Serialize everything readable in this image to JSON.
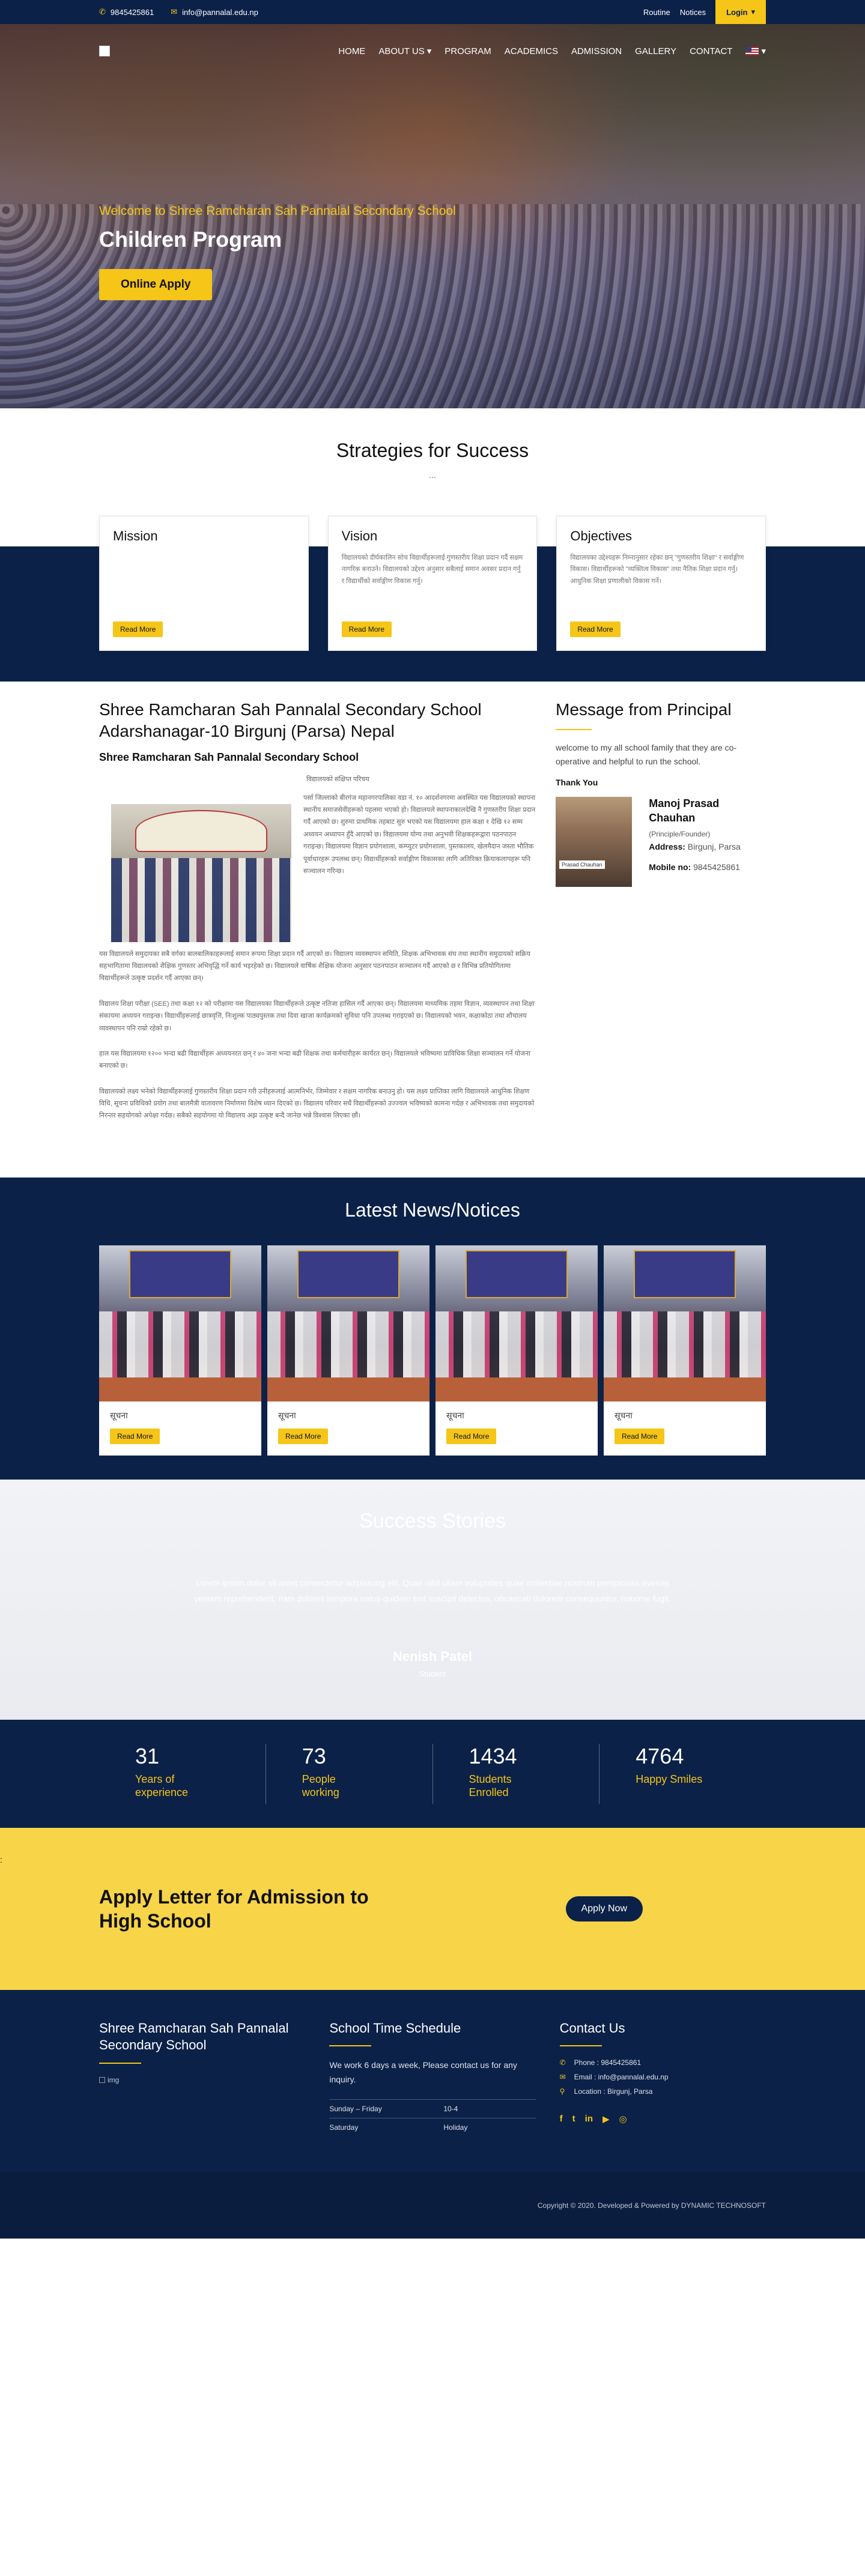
{
  "topbar": {
    "phone": "9845425861",
    "email": "info@pannalal.edu.np",
    "routine": "Routine",
    "notices": "Notices",
    "login": "Login"
  },
  "nav": {
    "items": [
      "HOME",
      "ABOUT US",
      "PROGRAM",
      "ACADEMICS",
      "ADMISSION",
      "GALLERY",
      "CONTACT"
    ]
  },
  "hero": {
    "subtitle": "Welcome to Shree Ramcharan Sah Pannalal Secondary School",
    "title": "Children Program",
    "button": "Online Apply"
  },
  "strategies": {
    "title": "Strategies for Success",
    "dots": "...",
    "cards": [
      {
        "title": "Mission",
        "text": "",
        "button": "Read More"
      },
      {
        "title": "Vision",
        "text": "विद्यालयको दीर्घकालिन सोच विद्यार्थीहरूलाई गुणस्तरीय शिक्षा प्रदान गर्दै सक्षम नागरिक बनाउने। विद्यालयको उद्देश्य अनुसार सबैलाई समान अवसर प्रदान गर्नु र विद्यार्थीको सर्वाङ्गीण विकास गर्नु।",
        "button": "Read More"
      },
      {
        "title": "Objectives",
        "text": "विद्यालयका उद्देश्यहरू निम्नानुसार रहेका छन् \"गुणस्तरीय शिक्षा\" र सर्वाङ्गीण विकास। विद्यार्थीहरूको \"व्यक्तित्व विकास\" तथा नैतिक शिक्षा प्रदान गर्नु। आधुनिक शिक्षा प्रणालीको विकास गर्ने।",
        "button": "Read More"
      }
    ]
  },
  "about": {
    "title": "Shree Ramcharan Sah Pannalal Secondary School Adarshanagar-10 Birgunj (Parsa) Nepal",
    "subtitle": "Shree Ramcharan Sah Pannalal Secondary School",
    "headline": "विद्यालयको संक्षिप्त परिचय",
    "p1": "पर्सा जिल्लाको बीरगंज महानगरपालिका वडा नं. १० आदर्शनगरमा अवस्थित यस विद्यालयको स्थापना स्थानीय समाजसेवीहरूको पहलमा भएको हो। विद्यालयले स्थापनाकालदेखि नै गुणस्तरीय शिक्षा प्रदान गर्दै आएको छ। शुरुमा प्राथमिक तहबाट सुरु भएको यस विद्यालयमा हाल कक्षा १ देखि १२ सम्म अध्ययन अध्यापन हुँदै आएको छ। विद्यालयमा योग्य तथा अनुभवी शिक्षकहरूद्वारा पठनपाठन गराइन्छ। विद्यालयमा विज्ञान प्रयोगशाला, कम्प्युटर प्रयोगशाला, पुस्तकालय, खेलमैदान जस्ता भौतिक पूर्वाधारहरू उपलब्ध छन्। विद्यार्थीहरूको सर्वाङ्गीण विकासका लागि अतिरिक्त क्रियाकलापहरू पनि सञ्चालन गरिन्छ।",
    "p2": "यस विद्यालयले समुदायका सबै वर्गका बालबालिकाहरूलाई समान रूपमा शिक्षा प्रदान गर्दै आएको छ। विद्यालय व्यवस्थापन समिति, शिक्षक अभिभावक संघ तथा स्थानीय समुदायको सक्रिय सहभागितामा विद्यालयको शैक्षिक गुणस्तर अभिवृद्धि गर्ने कार्य भइरहेको छ। विद्यालयले वार्षिक शैक्षिक योजना अनुसार पठनपाठन सञ्चालन गर्दै आएको छ र विभिन्न प्रतियोगितामा विद्यार्थीहरूले उत्कृष्ट प्रदर्शन गर्दै आएका छन्।",
    "p3": "विद्यालय शिक्षा परीक्षा (SEE) तथा कक्षा १२ को परीक्षामा यस विद्यालयका विद्यार्थीहरूले उत्कृष्ट नतिजा हासिल गर्दै आएका छन्। विद्यालयमा माध्यमिक तहमा विज्ञान, व्यवस्थापन तथा शिक्षा संकायमा अध्ययन गराइन्छ। विद्यार्थीहरूलाई छात्रवृत्ति, निःशुल्क पाठ्यपुस्तक तथा दिवा खाजा कार्यक्रमको सुविधा पनि उपलब्ध गराइएको छ। विद्यालयको भवन, कक्षाकोठा तथा शौचालय व्यवस्थापन पनि राम्रो रहेको छ।",
    "p4": "हाल यस विद्यालयमा १२०० भन्दा बढी विद्यार्थीहरू अध्ययनरत छन् र ४० जना भन्दा बढी शिक्षक तथा कर्मचारीहरू कार्यरत छन्। विद्यालयले भविष्यमा प्राविधिक शिक्षा सञ्चालन गर्ने योजना बनाएको छ।",
    "p5": "विद्यालयको लक्ष्य भनेको विद्यार्थीहरूलाई गुणस्तरीय शिक्षा प्रदान गरी उनीहरूलाई आत्मनिर्भर, जिम्मेवार र सक्षम नागरिक बनाउनु हो। यस लक्ष्य प्राप्तिका लागि विद्यालयले आधुनिक शिक्षण विधि, सूचना प्रविधिको प्रयोग तथा बालमैत्री वातावरण निर्माणमा विशेष ध्यान दिएको छ। विद्यालय परिवार सधैं विद्यार्थीहरूको उज्ज्वल भविष्यको कामना गर्दछ र अभिभावक तथा समुदायको निरन्तर सहयोगको अपेक्षा गर्दछ। सबैको सहयोगमा यो विद्यालय अझ उत्कृष्ट बन्दै जानेछ भन्ने विश्वास लिएका छौं।"
  },
  "principal": {
    "title": "Message from Principal",
    "message": "welcome to my all school family that they are co-operative and helpful to run the school.",
    "thanks": "Thank You",
    "name": "Manoj Prasad Chauhan",
    "role": "(Principle/Founder)",
    "address_label": "Address:",
    "address": "Birgunj, Parsa",
    "mobile_label": "Mobile no:",
    "mobile": "9845425861",
    "photo_tag": "Prasad Chauhan"
  },
  "news": {
    "title": "Latest News/Notices",
    "items": [
      {
        "title": "सूचना",
        "button": "Read More"
      },
      {
        "title": "सूचना",
        "button": "Read More"
      },
      {
        "title": "सूचना",
        "button": "Read More"
      },
      {
        "title": "सूचना",
        "button": "Read More"
      }
    ]
  },
  "success": {
    "title": "Success Stories",
    "quote": "Lorem ipsum dolor sit amet consectetur adipisicing elit. Quas nihil ullam voluptates quae molestiae nostrum perspiciatis eveniet veniam reprehenderit, nam dolores tempora natus quidem sint suscipit delectus, obcaecati dolorem consequuntur, maxime fugit.",
    "name": "Nenish Patel",
    "role": "Student"
  },
  "stats": [
    {
      "num": "31",
      "label": "Years of experience"
    },
    {
      "num": "73",
      "label": "People working"
    },
    {
      "num": "1434",
      "label": "Students Enrolled"
    },
    {
      "num": "4764",
      "label": "Happy Smiles"
    }
  ],
  "admission": {
    "title": "Apply Letter for Admission to High School",
    "button": "Apply Now",
    "edge": ":"
  },
  "footer": {
    "school": "Shree Ramcharan Sah Pannalal Secondary School",
    "img_alt": "img",
    "schedule_title": "School Time Schedule",
    "schedule_text": "We work 6 days a week, Please contact us for any inquiry.",
    "schedule": [
      {
        "day": "Sunday – Friday",
        "time": "10-4"
      },
      {
        "day": "Saturday",
        "time": "Holiday"
      }
    ],
    "contact_title": "Contact Us",
    "phone": "Phone : 9845425861",
    "email": "Email : info@pannalal.edu.np",
    "location": "Location : Birgunj, Parsa",
    "copyright": "Copyright © 2020. Developed & Powered by DYNAMIC TECHNOSOFT"
  }
}
